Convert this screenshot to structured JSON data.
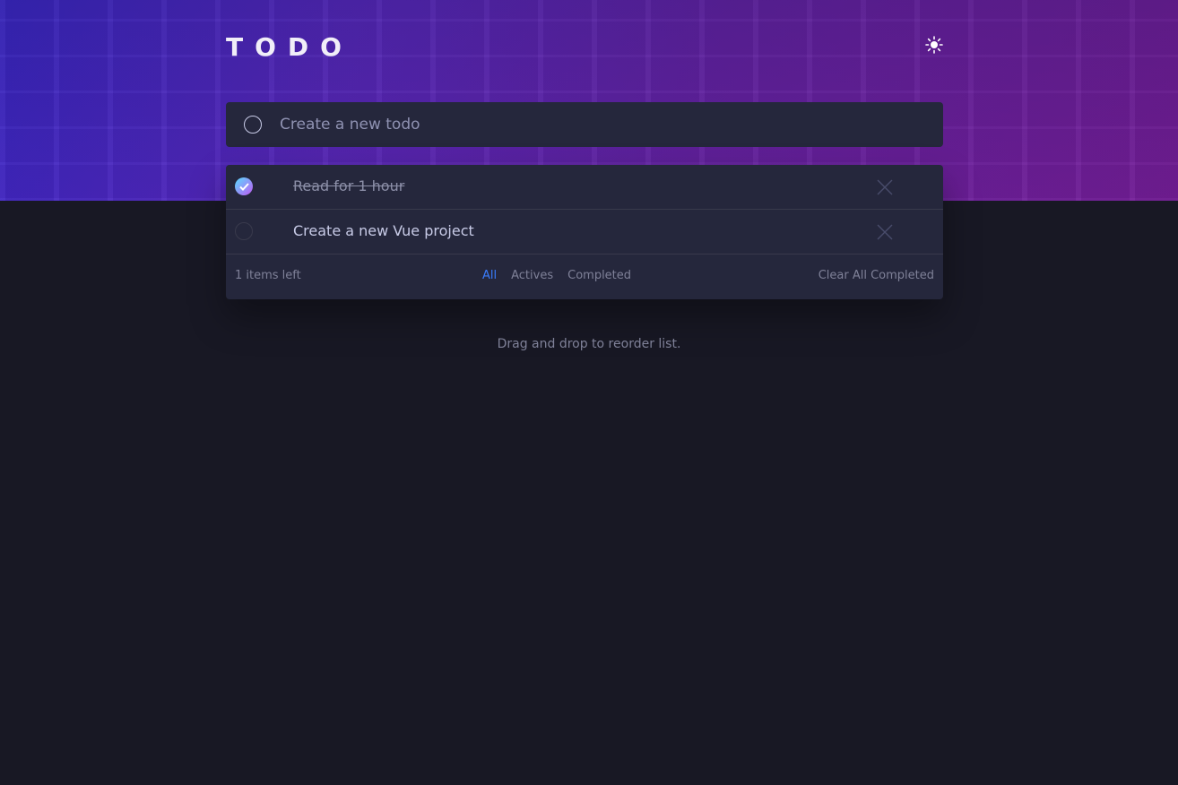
{
  "app": {
    "title": "TODO"
  },
  "header": {
    "theme_icon": "sun-icon"
  },
  "new_todo": {
    "placeholder": "Create a new todo",
    "value": ""
  },
  "todos": [
    {
      "label": "Read for 1 hour",
      "completed": true
    },
    {
      "label": "Create a new Vue project",
      "completed": false
    }
  ],
  "footer": {
    "items_left": "1 items left",
    "filters": [
      {
        "label": "All",
        "active": true
      },
      {
        "label": "Actives",
        "active": false
      },
      {
        "label": "Completed",
        "active": false
      }
    ],
    "clear_label": "Clear All Completed"
  },
  "hint": "Drag and drop to reorder list.",
  "colors": {
    "background": "#181824",
    "card": "#25273c",
    "text": "#c8cbe7",
    "muted": "#7f8198",
    "active_filter": "#3a7cfd",
    "check_gradient_start": "#57ddff",
    "check_gradient_end": "#c058f3"
  }
}
